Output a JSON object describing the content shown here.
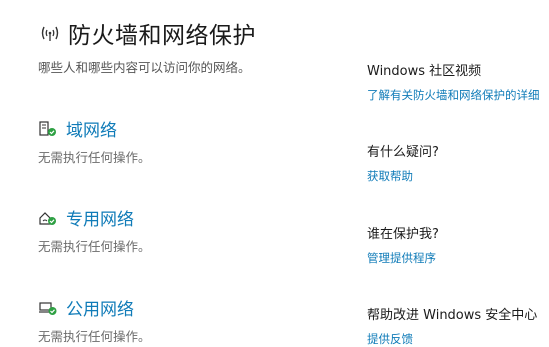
{
  "header": {
    "title": "防火墙和网络保护",
    "icon": "wifi-signal-icon",
    "subtitle": "哪些人和哪些内容可以访问你的网络。"
  },
  "networks": [
    {
      "title": "域网络",
      "status": "无需执行任何操作。",
      "icon": "domain-network-icon"
    },
    {
      "title": "专用网络",
      "status": "无需执行任何操作。",
      "icon": "private-network-icon"
    },
    {
      "title": "公用网络",
      "status": "无需执行任何操作。",
      "icon": "public-network-icon"
    }
  ],
  "side": {
    "video": {
      "heading": "Windows 社区视频",
      "link": "了解有关防火墙和网络保护的详细"
    },
    "question": {
      "heading": "有什么疑问?",
      "link": "获取帮助"
    },
    "protector": {
      "heading": "谁在保护我?",
      "link": "管理提供程序"
    },
    "feedback": {
      "heading": "帮助改进 Windows 安全中心",
      "link": "提供反馈"
    }
  },
  "colors": {
    "link": "#0f7bb8",
    "status_ok": "#2ea043"
  }
}
